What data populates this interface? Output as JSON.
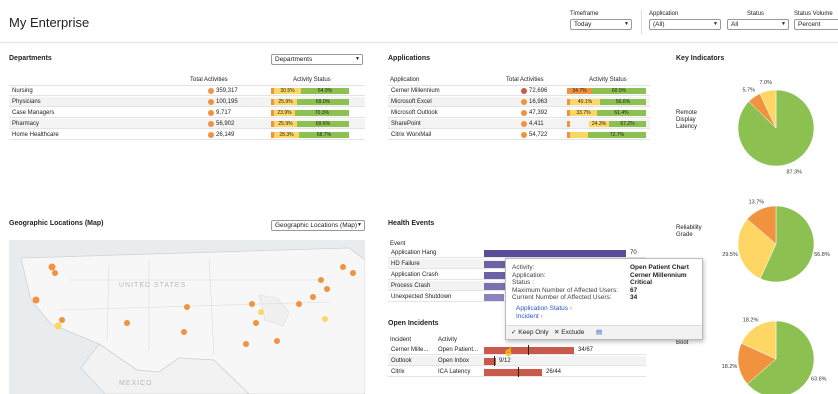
{
  "page_title": "My Enterprise",
  "filters": {
    "timeframe": {
      "label": "Timeframe",
      "value": "Today"
    },
    "application": {
      "label": "Application",
      "value": "(All)"
    },
    "status": {
      "label": "Status",
      "value": "All"
    },
    "status_volume": {
      "label": "Status Volume",
      "value": "Percent"
    }
  },
  "departments": {
    "title": "Departments",
    "dropdown": "Departments",
    "headers": [
      "Total Activities",
      "Activity Status"
    ],
    "rows": [
      {
        "name": "Nursing",
        "total": "359,317",
        "p1": "30.5%",
        "p2": "64.9%"
      },
      {
        "name": "Physicians",
        "total": "100,195",
        "p1": "25.9%",
        "p2": "69.0%"
      },
      {
        "name": "Case Managers",
        "total": "9,717",
        "p1": "23.9%",
        "p2": "70.3%"
      },
      {
        "name": "Pharmacy",
        "total": "56,902",
        "p1": "25.9%",
        "p2": "69.6%"
      },
      {
        "name": "Home Healthcare",
        "total": "26,149",
        "p1": "28.3%",
        "p2": "68.7%"
      }
    ]
  },
  "applications": {
    "title": "Applications",
    "headers": [
      "Application",
      "Total Activities",
      "Activity Status"
    ],
    "rows": [
      {
        "name": "Cerner Millennium",
        "total": "72,696",
        "p1": "34.7%",
        "p2": "60.9%"
      },
      {
        "name": "Microsoft Excel",
        "total": "16,963",
        "p1": "40.1%",
        "p2": "56.6%"
      },
      {
        "name": "Microsoft Outlook",
        "total": "47,392",
        "p1": "33.7%",
        "p2": "61.4%"
      },
      {
        "name": "SharePoint",
        "total": "4,411",
        "p1": "24.3%",
        "p2": "67.2%"
      },
      {
        "name": "Citrix WorxMail",
        "total": "54,722",
        "p1": "",
        "p2": "72.7%"
      }
    ]
  },
  "key_indicators": {
    "title": "Key Indicators",
    "labels": [
      "Remote Display Latency",
      "Reliability Grade",
      "Boot"
    ]
  },
  "geo": {
    "title": "Geographic Locations (Map)",
    "dropdown": "Geographic Locations (Map)",
    "map_labels": [
      "UNITED STATES",
      "MEXICO"
    ]
  },
  "health_events": {
    "title": "Health Events",
    "header": "Event",
    "rows": [
      "Application Hang",
      "HD Failure",
      "Application Crash",
      "Process Crash",
      "Unexpected Shutdown"
    ],
    "first_value": "70"
  },
  "tooltip": {
    "k1": "Activity:",
    "v1": "Open Patient Chart",
    "k2": "Application:",
    "v2": "Cerner Millennium",
    "k3": "Status :",
    "v3": "Critical",
    "k4": "Maximum Number of Affected Users:",
    "v4": "67",
    "k5": "Current Number of Affected Users:",
    "v5": "34",
    "link1": "Application Status",
    "link2": "Incident",
    "keep": "Keep Only",
    "exclude": "Exclude"
  },
  "open_incidents": {
    "title": "Open Incidents",
    "headers": [
      "Incident",
      "Activity"
    ],
    "rows": [
      {
        "incident": "Cerner Mille...",
        "activity": "Open Patient...",
        "value": "34/67"
      },
      {
        "incident": "Outlook",
        "activity": "Open Inbox",
        "value": "9/12"
      },
      {
        "incident": "Citrix",
        "activity": "ICA Latency",
        "value": "26/44"
      }
    ]
  },
  "colors": {
    "orange": "#f0923e",
    "yellow": "#fdd663",
    "green": "#8cc152",
    "purple": "#5b4c9a",
    "red": "#c9594a"
  },
  "chart_data": [
    {
      "type": "pie",
      "title": "Remote Display Latency",
      "values": [
        87.3,
        5.7,
        7.0
      ],
      "labels": [
        "87.3%",
        "5.7%",
        "7.0%"
      ],
      "colors": [
        "#8cc152",
        "#f0923e",
        "#fdd663"
      ]
    },
    {
      "type": "pie",
      "title": "Reliability Grade",
      "values": [
        56.8,
        29.5,
        13.7
      ],
      "labels": [
        "56.8%",
        "29.5%",
        "13.7%"
      ],
      "colors": [
        "#8cc152",
        "#fdd663",
        "#f0923e"
      ]
    },
    {
      "type": "pie",
      "title": "Boot",
      "values": [
        63.6,
        18.2,
        18.2
      ],
      "labels": [
        "63.6%",
        "18.2%",
        "18.2%"
      ],
      "colors": [
        "#8cc152",
        "#f0923e",
        "#fdd663"
      ]
    }
  ]
}
